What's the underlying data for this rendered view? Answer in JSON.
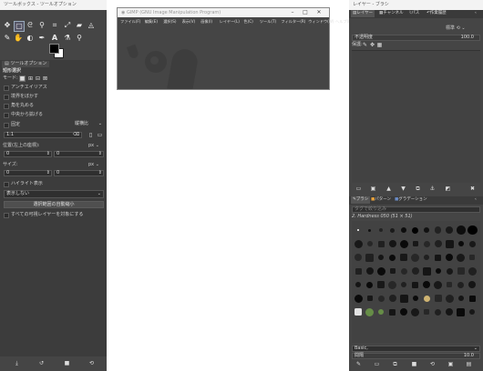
{
  "toolbox": {
    "title": "ツールボックス - ツールオプション",
    "options_tab": "ツールオプション",
    "tool_name": "短形選択",
    "mode_label": "モード:",
    "antialias": "アンチエイリアス",
    "feather": "境界をぼかす",
    "rounded": "角を丸める",
    "expand_center": "中央から拡げる",
    "fixed_label": "固定",
    "fixed_value": "縦横比",
    "ratio_value": "1:1",
    "position_label": "位置(左上の座標):",
    "unit1": "px",
    "pos_x": "0",
    "pos_y": "0",
    "size_label": "サイズ:",
    "unit2": "px",
    "size_w": "0",
    "size_h": "0",
    "highlight": "ハイライト表示",
    "guides": "表示しない",
    "autoshrink": "選択範囲の自動縮小",
    "shrink_merged": "すべての可視レイヤーを対象にする"
  },
  "gimp_window": {
    "title": "GIMP (GNU Image Manipulation Program)",
    "menu": [
      "ファイル(F)",
      "編集(E)",
      "選択(S)",
      "表示(V)",
      "画像(I)",
      "レイヤー(L)",
      "色(C)",
      "ツール(T)",
      "フィルター(R)",
      "ウィンドウ(W)",
      "ヘルプ(H)"
    ]
  },
  "layers_dock": {
    "title": "レイヤー - ブラシ",
    "tabs": [
      "レイヤー",
      "チャンネル",
      "パス",
      "作業履歴"
    ],
    "mode_value": "標準",
    "opacity_label": "不透明度",
    "opacity_value": "100.0",
    "lock_label": "保護:",
    "brush_tabs": [
      "ブラシ",
      "パターン",
      "グラデーション"
    ],
    "filter_placeholder": "タグで絞り込み",
    "brush_name": "2. Hardness 050 (51 × 51)",
    "tag_value": "Basic,",
    "spacing_label": "間隔",
    "spacing_value": "10.0"
  }
}
